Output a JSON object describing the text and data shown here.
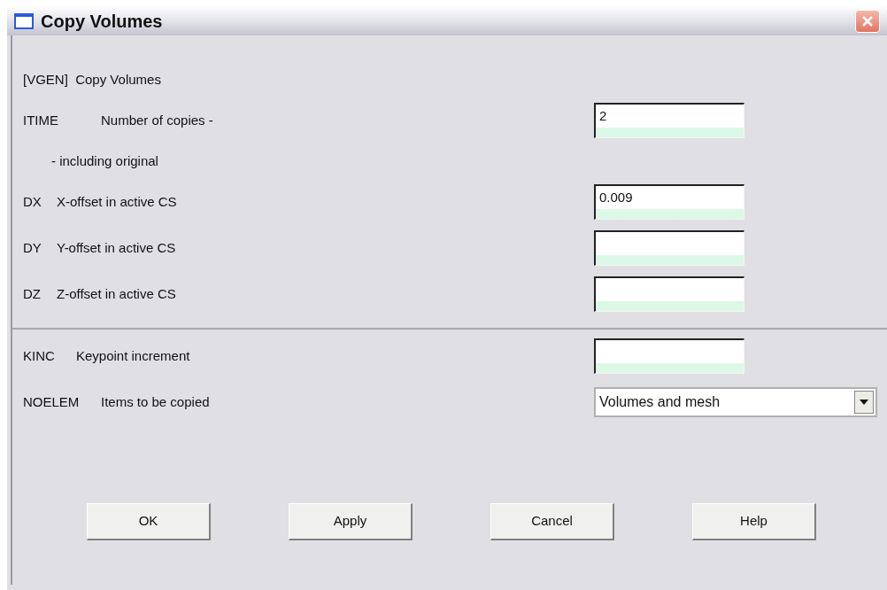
{
  "window": {
    "title": "Copy Volumes"
  },
  "header": "[VGEN]  Copy Volumes",
  "sections": [
    {
      "rows": [
        {
          "kind": "input",
          "code": "ITIME",
          "label": "Number of copies -",
          "value": "2"
        },
        {
          "kind": "note",
          "label": "- including original"
        },
        {
          "kind": "input",
          "code": "DX",
          "label": "X-offset in active CS",
          "value": "0.009"
        },
        {
          "kind": "input",
          "code": "DY",
          "label": "Y-offset in active CS",
          "value": ""
        },
        {
          "kind": "input",
          "code": "DZ",
          "label": "Z-offset in active CS",
          "value": ""
        }
      ]
    },
    {
      "rows": [
        {
          "kind": "input",
          "code": "KINC",
          "label": "Keypoint increment",
          "value": ""
        },
        {
          "kind": "dropdown",
          "code": "NOELEM",
          "label": "Items to be copied",
          "value": "Volumes and mesh"
        }
      ]
    }
  ],
  "buttons": [
    "OK",
    "Apply",
    "Cancel",
    "Help"
  ]
}
